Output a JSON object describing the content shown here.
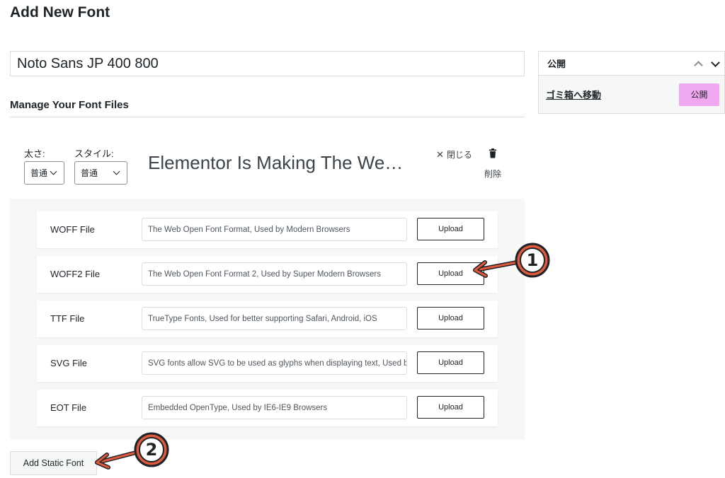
{
  "page": {
    "title": "Add New Font"
  },
  "font_title": {
    "value": "Noto Sans JP 400 800"
  },
  "section": {
    "heading": "Manage Your Font Files"
  },
  "publish": {
    "title": "公開",
    "trash_label": "ゴミ箱へ移動",
    "publish_label": "公開",
    "publish_color": "#f0a8f0"
  },
  "variation": {
    "weight_label": "太さ:",
    "weight_value": "普通",
    "style_label": "スタイル:",
    "style_value": "普通",
    "preview_text": "Elementor Is Making The Web Beautiful",
    "close_label": "閉じる",
    "delete_label": "削除"
  },
  "files": [
    {
      "name": "WOFF File",
      "description": "The Web Open Font Format, Used by Modern Browsers",
      "button": "Upload"
    },
    {
      "name": "WOFF2 File",
      "description": "The Web Open Font Format 2, Used by Super Modern Browsers",
      "button": "Upload"
    },
    {
      "name": "TTF File",
      "description": "TrueType Fonts, Used for better supporting Safari, Android, iOS",
      "button": "Upload"
    },
    {
      "name": "SVG File",
      "description": "SVG fonts allow SVG to be used as glyphs when displaying text, Used by iPhone",
      "button": "Upload"
    },
    {
      "name": "EOT File",
      "description": "Embedded OpenType, Used by IE6-IE9 Browsers",
      "button": "Upload"
    }
  ],
  "add_static_label": "Add Static Font",
  "annotations": {
    "one": "1",
    "two": "2",
    "color": "#e0593a"
  }
}
